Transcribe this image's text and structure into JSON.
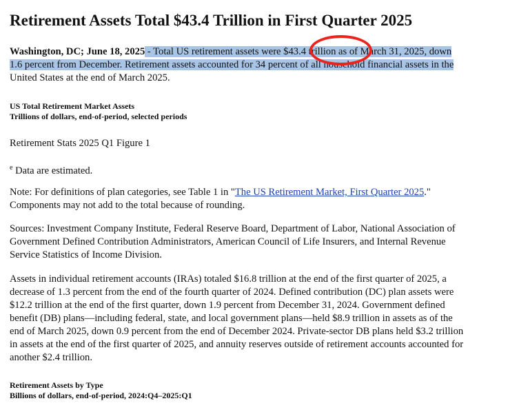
{
  "title": "Retirement Assets Total $43.4 Trillion in First Quarter 2025",
  "lead": {
    "dateline": "Washington, DC; June 18, 2025",
    "line1": " - Total US retirement assets were $43.4 trillion as of March 31, 2025, down",
    "line2": "1.6 percent from December. Retirement assets accounted for 34 percent of all household financial assets in the",
    "line3": "United States at the end of March 2025."
  },
  "figure1": {
    "heading1": "US Total Retirement Market Assets",
    "heading2": "Trillions of dollars, end-of-period, selected periods",
    "caption": "Retirement Stats 2025 Q1 Figure 1"
  },
  "estimated_note": {
    "marker": "e",
    "text": " Data are estimated."
  },
  "note": {
    "prefix": "Note: For definitions of plan categories, see Table 1 in \"",
    "link_text": "The US Retirement Market, First Quarter 2025",
    "suffix": ".\"",
    "line2": "Components may not add to the total because of rounding."
  },
  "sources": {
    "line1": "Sources: Investment Company Institute, Federal Reserve Board, Department of Labor, National Association of",
    "line2": "Government Defined Contribution Administrators, American Council of Life Insurers, and Internal Revenue",
    "line3": "Service Statistics of Income Division."
  },
  "body": {
    "line1": "Assets in individual retirement accounts (IRAs) totaled $16.8 trillion at the end of the first quarter of 2025, a",
    "line2": "decrease of 1.3 percent from the end of the fourth quarter of 2024. Defined contribution (DC) plan assets were",
    "line3": "$12.2 trillion at the end of the first quarter, down 1.9 percent from December 31, 2024. Government defined",
    "line4": "benefit (DB) plans—including federal, state, and local government plans—held $8.9 trillion in assets as of the",
    "line5": "end of March 2025, down 0.9 percent from the end of December 2024. Private-sector DB plans held $3.2 trillion",
    "line6": "in assets at the end of the first quarter of 2025, and annuity reserves outside of retirement accounts accounted for",
    "line7": "another $2.4 trillion."
  },
  "figure2": {
    "heading1": "Retirement Assets by Type",
    "heading2": "Billions of dollars, end-of-period, 2024:Q4–2025:Q1"
  },
  "colors": {
    "highlight": "#a9c5e6",
    "annotation": "#e8241c",
    "link": "#1a3fb3"
  }
}
